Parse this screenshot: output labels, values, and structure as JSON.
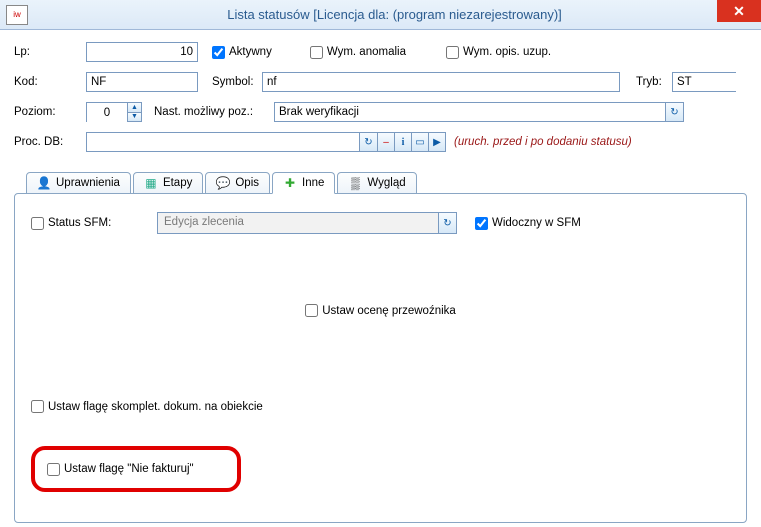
{
  "title": "Lista statusów  [Licencja dla: (program niezarejestrowany)]",
  "row1": {
    "lp_label": "Lp:",
    "lp_value": "10",
    "aktywny": "Aktywny",
    "wym_anom": "Wym. anomalia",
    "wym_opis": "Wym. opis. uzup."
  },
  "row2": {
    "kod_label": "Kod:",
    "kod_value": "NF",
    "symbol_label": "Symbol:",
    "symbol_value": "nf",
    "tryb_label": "Tryb:",
    "tryb_value": "ST"
  },
  "row3": {
    "poziom_label": "Poziom:",
    "poziom_value": "0",
    "nast_label": "Nast. możliwy poz.:",
    "nast_value": "Brak weryfikacji"
  },
  "row4": {
    "proc_label": "Proc. DB:",
    "proc_value": "",
    "proc_note": "(uruch. przed i po dodaniu statusu)"
  },
  "tabs": {
    "t1": "Uprawnienia",
    "t2": "Etapy",
    "t3": "Opis",
    "t4": "Inne",
    "t5": "Wygląd"
  },
  "inne": {
    "status_sfm_label": "Status SFM:",
    "status_sfm_value": "Edycja zlecenia",
    "widoczny": "Widoczny w SFM",
    "ustaw_ocena": "Ustaw ocenę przewoźnika",
    "ustaw_flage_skom": "Ustaw flagę skomplet. dokum. na obiekcie",
    "ustaw_nie_fakturuj": "Ustaw flagę \"Nie fakturuj\""
  }
}
